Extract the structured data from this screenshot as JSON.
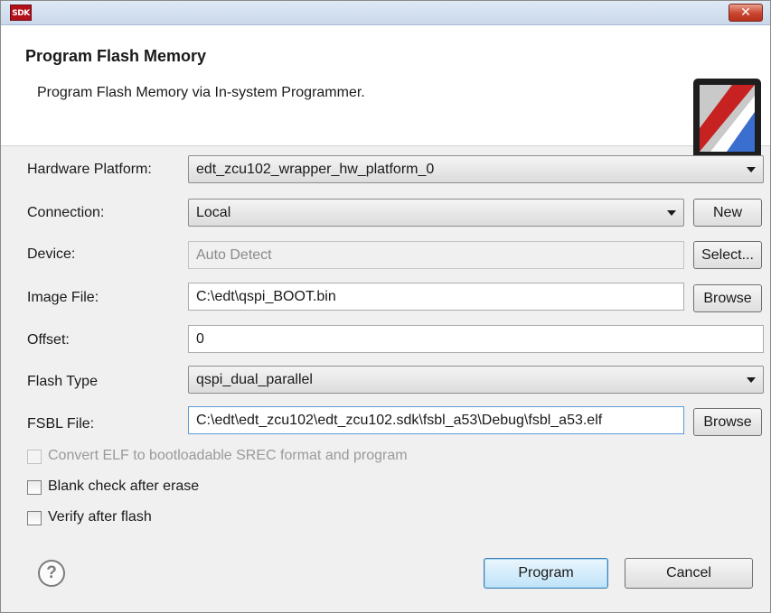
{
  "window": {
    "app_icon_text": "SDK",
    "close_icon": "close-x-icon",
    "close_glyph": "✕"
  },
  "banner": {
    "title": "Program Flash Memory",
    "description": "Program Flash Memory via In-system Programmer.",
    "graphic_icon": "flash-memory-card-icon"
  },
  "form": {
    "hardware_platform": {
      "label": "Hardware Platform:",
      "value": "edt_zcu102_wrapper_hw_platform_0"
    },
    "connection": {
      "label": "Connection:",
      "value": "Local",
      "button": "New"
    },
    "device": {
      "label": "Device:",
      "value": "Auto Detect",
      "button": "Select..."
    },
    "image_file": {
      "label": "Image File:",
      "value": "C:\\edt\\qspi_BOOT.bin",
      "button": "Browse"
    },
    "offset": {
      "label": "Offset:",
      "value": "0"
    },
    "flash_type": {
      "label": "Flash Type",
      "value": "qspi_dual_parallel"
    },
    "fsbl_file": {
      "label": "FSBL File:",
      "value": "C:\\edt\\edt_zcu102\\edt_zcu102.sdk\\fsbl_a53\\Debug\\fsbl_a53.elf",
      "button": "Browse"
    }
  },
  "options": {
    "convert_elf": {
      "label": "Convert ELF to bootloadable SREC format and program",
      "checked": false,
      "enabled": false
    },
    "blank_check": {
      "label": "Blank check after erase",
      "checked": false,
      "enabled": true
    },
    "verify": {
      "label": "Verify after flash",
      "checked": false,
      "enabled": true
    }
  },
  "footer": {
    "help_icon": "help-question-icon",
    "help_glyph": "?",
    "program_button": "Program",
    "cancel_button": "Cancel"
  }
}
